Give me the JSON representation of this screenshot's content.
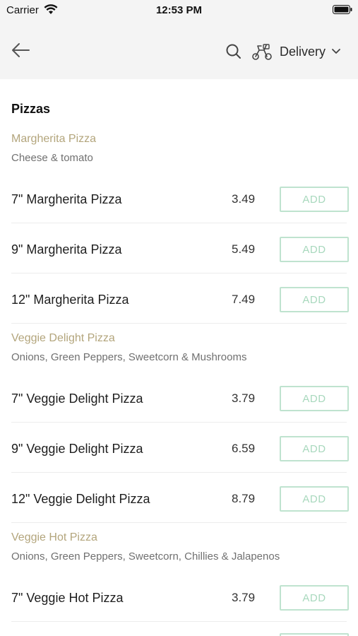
{
  "status_bar": {
    "carrier": "Carrier",
    "time": "12:53 PM"
  },
  "nav": {
    "back_icon": "arrow-left-icon",
    "search_icon": "search-icon",
    "delivery_icon": "scooter-icon",
    "delivery_label": "Delivery",
    "dropdown_icon": "chevron-down-icon"
  },
  "section": {
    "title": "Pizzas"
  },
  "groups": [
    {
      "name": "Margherita Pizza",
      "description": "Cheese & tomato",
      "items": [
        {
          "name": "7\" Margherita Pizza",
          "price": "3.49",
          "button": "ADD"
        },
        {
          "name": "9\" Margherita Pizza",
          "price": "5.49",
          "button": "ADD"
        },
        {
          "name": "12\" Margherita Pizza",
          "price": "7.49",
          "button": "ADD"
        }
      ]
    },
    {
      "name": "Veggie Delight Pizza",
      "description": "Onions, Green Peppers, Sweetcorn & Mushrooms",
      "items": [
        {
          "name": "7\" Veggie Delight Pizza",
          "price": "3.79",
          "button": "ADD"
        },
        {
          "name": "9\" Veggie Delight Pizza",
          "price": "6.59",
          "button": "ADD"
        },
        {
          "name": "12\" Veggie Delight Pizza",
          "price": "8.79",
          "button": "ADD"
        }
      ]
    },
    {
      "name": "Veggie Hot Pizza",
      "description": "Onions, Green Peppers, Sweetcorn, Chillies & Jalapenos",
      "items": [
        {
          "name": "7\" Veggie Hot Pizza",
          "price": "3.79",
          "button": "ADD"
        }
      ]
    }
  ],
  "colors": {
    "accent_gold": "#b3a57c",
    "add_button_border": "#bfe3cf",
    "add_button_text": "#a8d8bd",
    "header_background": "#f4f4f4"
  }
}
